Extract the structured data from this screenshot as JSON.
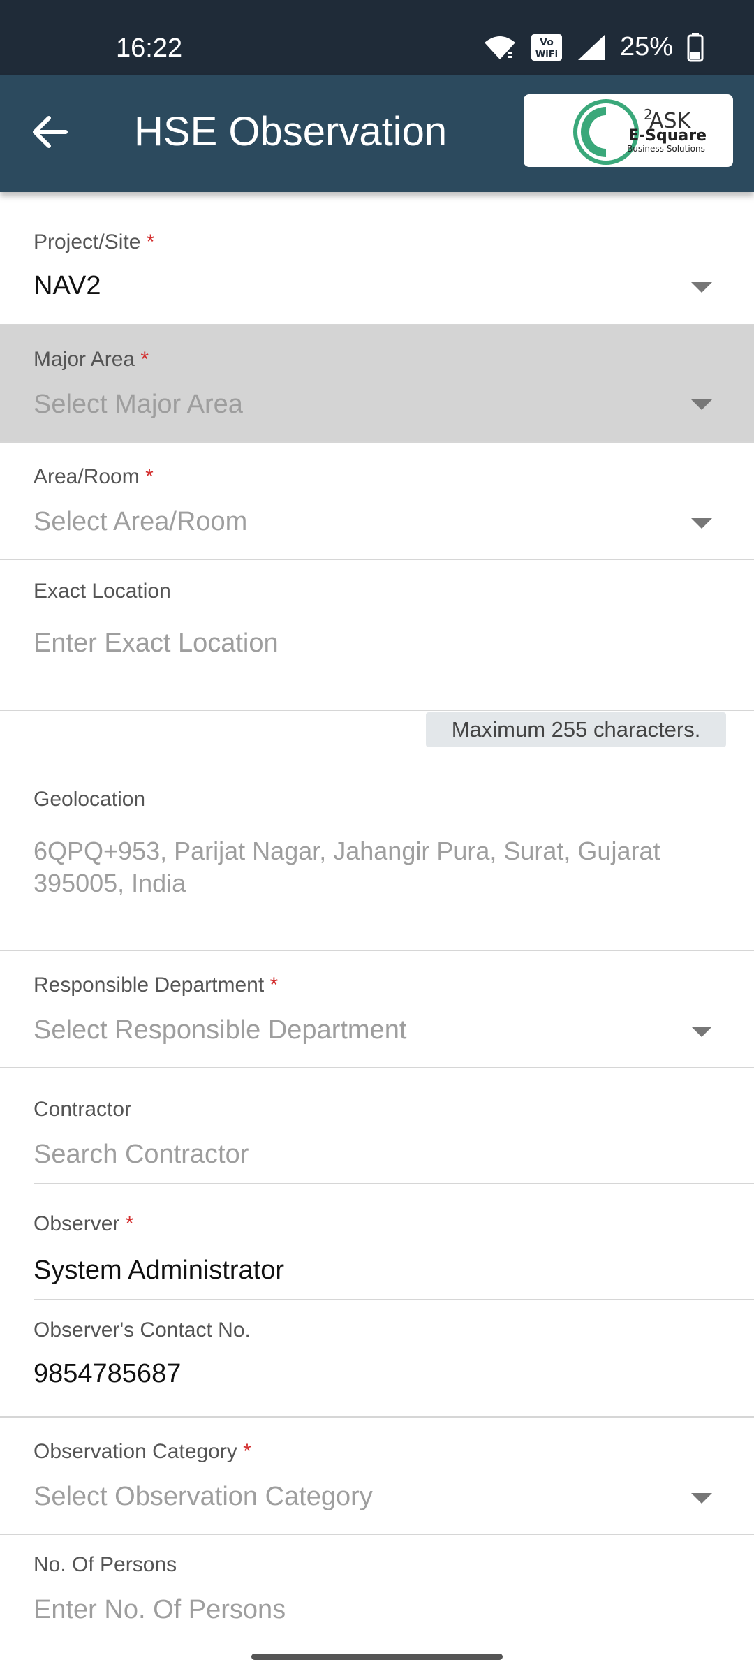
{
  "status_bar": {
    "time": "16:22",
    "battery": "25%",
    "icons": [
      "wifi-icon",
      "vowifi-icon",
      "signal-icon",
      "battery-icon"
    ]
  },
  "app_bar": {
    "title": "HSE Observation",
    "back_icon": "arrow-left-icon",
    "logo": {
      "brand": "E-Square",
      "sub": "Business Solutions",
      "mark": "ASK",
      "superscript": "2"
    }
  },
  "form": {
    "project": {
      "label": "Project/Site",
      "required": "*",
      "value": "NAV2"
    },
    "major_area": {
      "label": "Major Area",
      "required": "*",
      "placeholder": "Select Major Area"
    },
    "area_room": {
      "label": "Area/Room",
      "required": "*",
      "placeholder": "Select Area/Room"
    },
    "exact_location": {
      "label": "Exact Location",
      "placeholder": "Enter Exact Location",
      "hint": "Maximum 255 characters."
    },
    "geolocation": {
      "label": "Geolocation",
      "value_line1": "6QPQ+953, Parijat Nagar, Jahangir Pura, Surat, Gujarat",
      "value_line2": "395005, India"
    },
    "responsible_department": {
      "label": "Responsible Department",
      "required": "*",
      "placeholder": "Select Responsible Department"
    },
    "contractor": {
      "label": "Contractor",
      "placeholder": "Search Contractor"
    },
    "observer": {
      "label": "Observer",
      "required": "*",
      "value": "System Administrator"
    },
    "observer_contact": {
      "label": "Observer's Contact No.",
      "value": "9854785687"
    },
    "observation_category": {
      "label": "Observation Category",
      "required": "*",
      "placeholder": "Select Observation Category"
    },
    "no_of_persons": {
      "label": "No. Of Persons",
      "placeholder": "Enter No. Of Persons"
    }
  },
  "colors": {
    "status_bar": "#1f2b38",
    "app_bar": "#2c4a5e",
    "required": "#d32f2f",
    "disabled_bg": "#d4d4d4",
    "logo_green": "#3aa87a"
  }
}
